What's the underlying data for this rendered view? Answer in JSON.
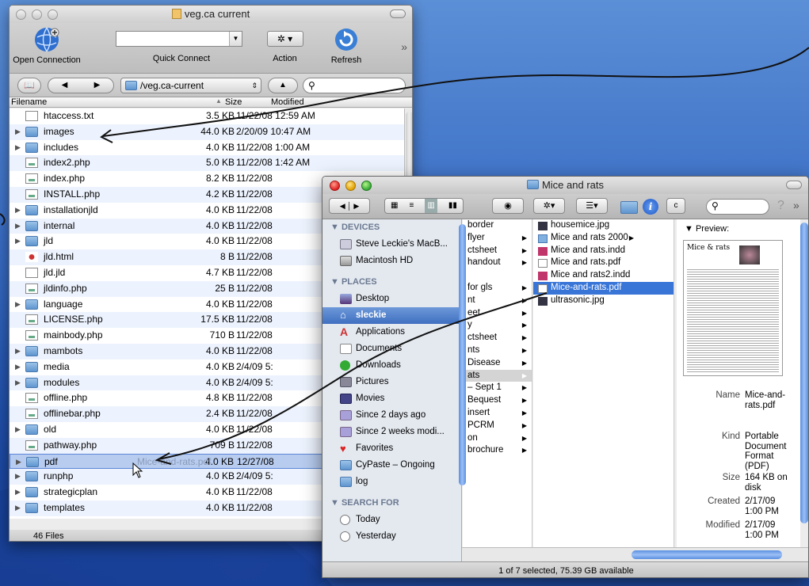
{
  "w1": {
    "title": "veg.ca current",
    "toolbar": {
      "open_connection": "Open Connection",
      "quick_connect": "Quick Connect",
      "action": "Action",
      "refresh": "Refresh"
    },
    "path": "/veg.ca-current",
    "search_placeholder": "",
    "columns": {
      "filename": "Filename",
      "size": "Size",
      "modified": "Modified"
    },
    "files": [
      {
        "name": "htaccess.txt",
        "type": "doc",
        "size": "3.5 KB",
        "modified": "11/22/08 12:59 AM"
      },
      {
        "name": "images",
        "type": "folder",
        "size": "44.0 KB",
        "modified": "2/20/09 10:47 AM"
      },
      {
        "name": "includes",
        "type": "folder",
        "size": "4.0 KB",
        "modified": "11/22/08 1:00 AM"
      },
      {
        "name": "index2.php",
        "type": "php",
        "size": "5.0 KB",
        "modified": "11/22/08 1:42 AM"
      },
      {
        "name": "index.php",
        "type": "php",
        "size": "8.2 KB",
        "modified": "11/22/08"
      },
      {
        "name": "INSTALL.php",
        "type": "php",
        "size": "4.2 KB",
        "modified": "11/22/08"
      },
      {
        "name": "installationjld",
        "type": "folder",
        "size": "4.0 KB",
        "modified": "11/22/08"
      },
      {
        "name": "internal",
        "type": "folder",
        "size": "4.0 KB",
        "modified": "11/22/08"
      },
      {
        "name": "jld",
        "type": "folder",
        "size": "4.0 KB",
        "modified": "11/22/08"
      },
      {
        "name": "jld.html",
        "type": "html",
        "size": "8 B",
        "modified": "11/22/08"
      },
      {
        "name": "jld.jld",
        "type": "doc",
        "size": "4.7 KB",
        "modified": "11/22/08"
      },
      {
        "name": "jldinfo.php",
        "type": "php",
        "size": "25 B",
        "modified": "11/22/08"
      },
      {
        "name": "language",
        "type": "folder",
        "size": "4.0 KB",
        "modified": "11/22/08"
      },
      {
        "name": "LICENSE.php",
        "type": "php",
        "size": "17.5 KB",
        "modified": "11/22/08"
      },
      {
        "name": "mainbody.php",
        "type": "php",
        "size": "710 B",
        "modified": "11/22/08"
      },
      {
        "name": "mambots",
        "type": "folder",
        "size": "4.0 KB",
        "modified": "11/22/08"
      },
      {
        "name": "media",
        "type": "folder",
        "size": "4.0 KB",
        "modified": "2/4/09 5:"
      },
      {
        "name": "modules",
        "type": "folder",
        "size": "4.0 KB",
        "modified": "2/4/09 5:"
      },
      {
        "name": "offline.php",
        "type": "php",
        "size": "4.8 KB",
        "modified": "11/22/08"
      },
      {
        "name": "offlinebar.php",
        "type": "php",
        "size": "2.4 KB",
        "modified": "11/22/08"
      },
      {
        "name": "old",
        "type": "folder",
        "size": "4.0 KB",
        "modified": "11/22/08"
      },
      {
        "name": "pathway.php",
        "type": "php",
        "size": "709 B",
        "modified": "11/22/08"
      },
      {
        "name": "pdf",
        "type": "folder",
        "size": "4.0 KB",
        "modified": "12/27/08",
        "selected": true
      },
      {
        "name": "runphp",
        "type": "folder",
        "size": "4.0 KB",
        "modified": "2/4/09 5:"
      },
      {
        "name": "strategicplan",
        "type": "folder",
        "size": "4.0 KB",
        "modified": "11/22/08"
      },
      {
        "name": "templates",
        "type": "folder",
        "size": "4.0 KB",
        "modified": "11/22/08"
      }
    ],
    "drag_ghost": "Mice-and-rats.pdf",
    "status": "46 Files"
  },
  "w2": {
    "title": "Mice and rats",
    "sidebar": {
      "devices_header": "DEVICES",
      "devices": [
        "Steve Leckie's MacB...",
        "Macintosh HD"
      ],
      "places_header": "PLACES",
      "places": [
        "Desktop",
        "sleckie",
        "Applications",
        "Documents",
        "Downloads",
        "Pictures",
        "Movies",
        "Since 2 days ago",
        "Since 2 weeks modi...",
        "Favorites",
        "CyPaste – Ongoing",
        "log"
      ],
      "search_header": "SEARCH FOR",
      "search": [
        "Today",
        "Yesterday"
      ]
    },
    "col1": [
      "border",
      "flyer",
      "ctsheet",
      "handout",
      "",
      "for gls",
      "nt",
      "eet",
      "y",
      "ctsheet",
      "nts",
      "Disease",
      "ats",
      "– Sept 1",
      "Bequest",
      "insert",
      "PCRM",
      "on",
      "brochure"
    ],
    "col2": [
      "housemice.jpg",
      "Mice and rats 2000",
      "Mice and rats.indd",
      "Mice and rats.pdf",
      "Mice and rats2.indd",
      "Mice-and-rats.pdf",
      "ultrasonic.jpg"
    ],
    "preview_label": "Preview:",
    "thumb_title": "Mice & rats",
    "info": [
      {
        "k": "Name",
        "v": "Mice-and-rats.pdf"
      },
      {
        "k": "Kind",
        "v": "Portable Document Format (PDF)"
      },
      {
        "k": "Size",
        "v": "164 KB on disk"
      },
      {
        "k": "Created",
        "v": "2/17/09 1:00 PM"
      },
      {
        "k": "Modified",
        "v": "2/17/09 1:00 PM"
      }
    ],
    "status": "1 of 7 selected, 75.39 GB available"
  }
}
